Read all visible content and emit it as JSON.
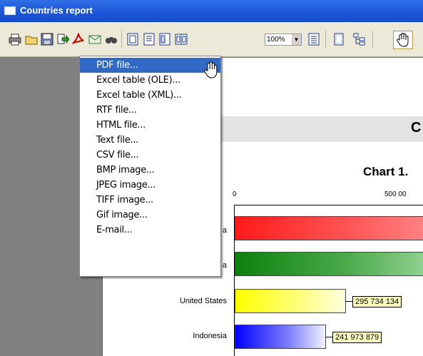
{
  "window": {
    "title": "Countries report"
  },
  "toolbar": {
    "icons": [
      "print-icon",
      "open-icon",
      "save-icon",
      "export-icon",
      "pdf-icon",
      "email-icon",
      "find-icon",
      "one-page-icon",
      "page-width-icon",
      "two-pages-icon",
      "four-pages-icon",
      "zoom-dropdown",
      "outline-icon",
      "page-setup-icon",
      "tree-icon",
      "hand-tool-icon"
    ],
    "zoom_value": "100%"
  },
  "export_menu": {
    "items": [
      "PDF file...",
      "Excel table (OLE)...",
      "Excel table (XML)...",
      "RTF file...",
      "HTML file...",
      "Text file...",
      "CSV file...",
      "BMP image...",
      "JPEG image...",
      "TIFF image...",
      "Gif image...",
      "E-mail..."
    ],
    "selected_index": 0
  },
  "report": {
    "band_letter": "C",
    "chart_title": "Chart 1.",
    "left_margin_glyph": "[",
    "axis_ticks": [
      "0",
      "500 00"
    ],
    "rows": [
      {
        "label_fragment": "a",
        "value_label": "",
        "color": "#ff2020"
      },
      {
        "label_fragment": "a",
        "value_label": "",
        "color": "#1a8a1a"
      },
      {
        "label": "United States",
        "value_label": "295 734 134",
        "color": "#ffff00"
      },
      {
        "label": "Indonesia",
        "value_label": "241 973 879",
        "color": "#1a1aff"
      }
    ]
  }
}
